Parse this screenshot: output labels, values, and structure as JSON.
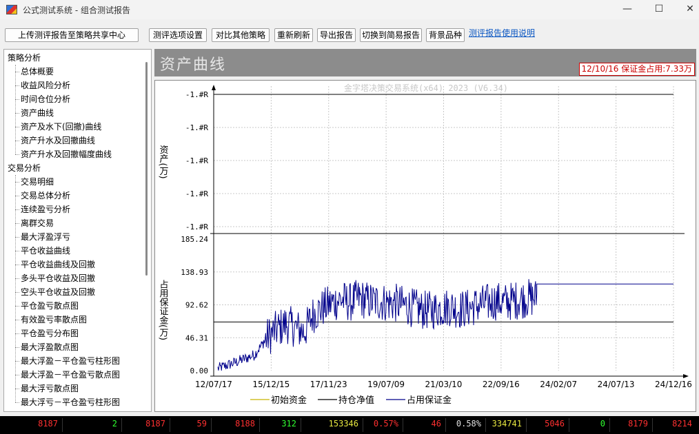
{
  "window": {
    "title": "公式测试系统 - 组合测试报告",
    "minimize": "—",
    "maximize": "☐",
    "close": "✕"
  },
  "toolbar": {
    "upload": "上传测评报告至策略共享中心",
    "options": "测评选项设置",
    "compare": "对比其他策略",
    "refresh": "重新刷新",
    "export": "导出报告",
    "simple": "切换到简易报告",
    "background": "背景品种",
    "help_link": "测评报告使用说明"
  },
  "sidebar": {
    "groups": [
      {
        "label": "策略分析",
        "items": [
          "总体概要",
          "收益风险分析",
          "时间仓位分析",
          "资产曲线",
          "资产及水下(回撤)曲线",
          "资产升水及回撤曲线",
          "资产升水及回撤幅度曲线"
        ]
      },
      {
        "label": "交易分析",
        "items": [
          "交易明细",
          "交易总体分析",
          "连续盈亏分析",
          "离群交易",
          "最大浮盈浮亏",
          "平仓收益曲线",
          "平仓收益曲线及回撤",
          "多头平仓收益及回撤",
          "空头平仓收益及回撤",
          "平仓盈亏散点图",
          "有效盈亏率散点图",
          "平仓盈亏分布图",
          "最大浮盈散点图",
          "最大浮盈－平仓盈亏柱形图",
          "最大浮盈－平仓盈亏散点图",
          "最大浮亏散点图",
          "最大浮亏－平仓盈亏柱形图"
        ]
      }
    ]
  },
  "main": {
    "title": "资产曲线",
    "status": "12/10/16 保证金占用:7.33万"
  },
  "chart_data": {
    "type": "line",
    "watermark": "金字塔决策交易系统(x64) 2023 (V6.34)",
    "colors": {
      "initial": "#c8b400",
      "net": "#000000",
      "margin": "#00008b",
      "grid": "#c8c8c8"
    },
    "x_ticks": [
      "12/07/17",
      "15/12/15",
      "17/11/23",
      "19/07/09",
      "21/03/10",
      "22/09/16",
      "24/02/07",
      "24/07/13",
      "24/12/16"
    ],
    "top_panel": {
      "ylabel": "资产(万)",
      "y_ticks": [
        "-1.#R",
        "-1.#R",
        "-1.#R",
        "-1.#R",
        "-1.#R"
      ]
    },
    "bottom_panel": {
      "ylabel": "占用保证金(万)",
      "ylim": [
        0,
        185.24
      ],
      "y_ticks": [
        "185.24",
        "138.93",
        "92.62",
        "46.31",
        "0.00"
      ],
      "reference_level": 68.5,
      "final_level": 122.0,
      "margin_control_points": [
        [
          0,
          3
        ],
        [
          0.04,
          12
        ],
        [
          0.08,
          22
        ],
        [
          0.11,
          48
        ],
        [
          0.13,
          58
        ],
        [
          0.15,
          66
        ],
        [
          0.17,
          60
        ],
        [
          0.19,
          55
        ],
        [
          0.21,
          80
        ],
        [
          0.23,
          88
        ],
        [
          0.25,
          95
        ],
        [
          0.27,
          100
        ],
        [
          0.29,
          96
        ],
        [
          0.31,
          102
        ],
        [
          0.33,
          98
        ],
        [
          0.35,
          97
        ],
        [
          0.37,
          96
        ],
        [
          0.39,
          95
        ],
        [
          0.41,
          92
        ],
        [
          0.43,
          88
        ],
        [
          0.45,
          85
        ],
        [
          0.47,
          85
        ],
        [
          0.49,
          88
        ],
        [
          0.51,
          90
        ],
        [
          0.53,
          86
        ],
        [
          0.55,
          88
        ],
        [
          0.57,
          92
        ],
        [
          0.59,
          95
        ],
        [
          0.61,
          98
        ],
        [
          0.63,
          96
        ],
        [
          0.66,
          100
        ],
        [
          0.68,
          102
        ],
        [
          0.7,
          103
        ]
      ],
      "margin_end_fraction": 0.7
    },
    "legend": [
      {
        "name": "初始资金",
        "color": "#c8b400"
      },
      {
        "name": "持仓净值",
        "color": "#000000"
      },
      {
        "name": "占用保证金",
        "color": "#00008b"
      }
    ]
  },
  "bottom_strip": {
    "cells": [
      {
        "text": "8187",
        "color": "#ff3030"
      },
      {
        "text": "2",
        "color": "#30ff30"
      },
      {
        "text": "8187",
        "color": "#ff3030"
      },
      {
        "text": "59",
        "color": "#ff3030"
      },
      {
        "text": "8188",
        "color": "#ff3030"
      },
      {
        "text": "312",
        "color": "#30ff30"
      },
      {
        "text": "153346",
        "color": "#e8e840"
      },
      {
        "text": "0.57%",
        "color": "#ff3030"
      },
      {
        "text": "46",
        "color": "#ff3030"
      },
      {
        "text": "0.58%",
        "color": "#e0e0e0"
      },
      {
        "text": "334741",
        "color": "#e8e840"
      },
      {
        "text": "5046",
        "color": "#ff3030"
      },
      {
        "text": "0",
        "color": "#30ff30"
      },
      {
        "text": "8179",
        "color": "#ff3030"
      },
      {
        "text": "8214",
        "color": "#ff3030"
      }
    ]
  }
}
